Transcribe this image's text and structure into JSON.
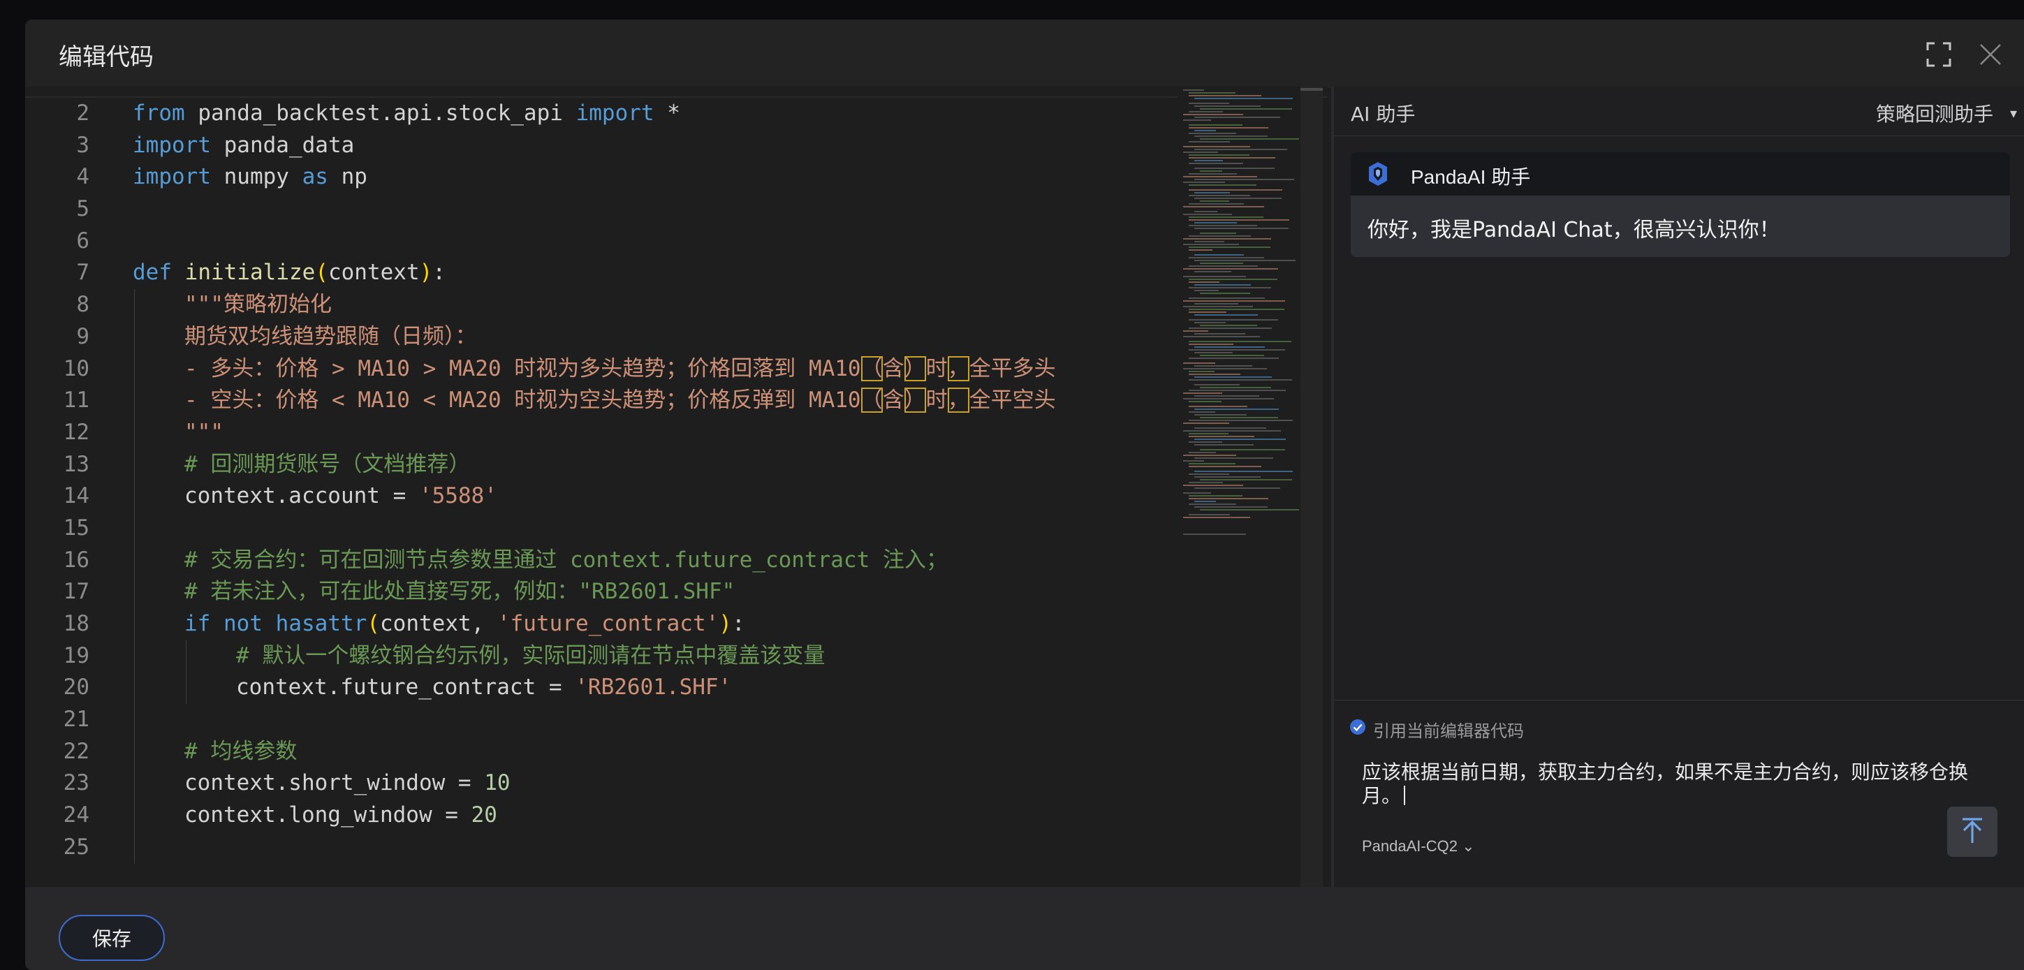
{
  "modal": {
    "title": "编辑代码",
    "icons": {
      "fullscreen": "fullscreen-icon",
      "close": "close-icon"
    }
  },
  "editor": {
    "lines": [
      {
        "num": "2",
        "tokens": [
          {
            "t": "from",
            "c": "kw"
          },
          {
            "t": " panda_backtest.api.stock_api ",
            "c": ""
          },
          {
            "t": "import",
            "c": "kw"
          },
          {
            "t": " *",
            "c": ""
          }
        ]
      },
      {
        "num": "3",
        "tokens": [
          {
            "t": "import",
            "c": "kw"
          },
          {
            "t": " panda_data",
            "c": ""
          }
        ]
      },
      {
        "num": "4",
        "tokens": [
          {
            "t": "import",
            "c": "kw"
          },
          {
            "t": " numpy ",
            "c": ""
          },
          {
            "t": "as",
            "c": "kw"
          },
          {
            "t": " np",
            "c": ""
          }
        ]
      },
      {
        "num": "5",
        "tokens": []
      },
      {
        "num": "6",
        "tokens": []
      },
      {
        "num": "7",
        "tokens": [
          {
            "t": "def",
            "c": "kw"
          },
          {
            "t": " ",
            "c": ""
          },
          {
            "t": "initialize",
            "c": "fn"
          },
          {
            "t": "(",
            "c": "paren"
          },
          {
            "t": "context",
            "c": ""
          },
          {
            "t": ")",
            "c": "paren"
          },
          {
            "t": ":",
            "c": ""
          }
        ]
      },
      {
        "num": "8",
        "indent": 1,
        "tokens": [
          {
            "t": "\"\"\"策略初始化",
            "c": "doc"
          }
        ]
      },
      {
        "num": "9",
        "indent": 1,
        "tokens": [
          {
            "t": "期货双均线趋势跟随（日频）：",
            "c": "doc"
          }
        ]
      },
      {
        "num": "10",
        "indent": 1,
        "tokens": [
          {
            "t": "- 多头：价格 > MA10 > MA20 时视为多头趋势；价格回落到 MA10",
            "c": "doc"
          },
          {
            "t": "（",
            "c": "doc hl"
          },
          {
            "t": "含",
            "c": "doc"
          },
          {
            "t": "）",
            "c": "doc hl"
          },
          {
            "t": "时",
            "c": "doc"
          },
          {
            "t": "，",
            "c": "doc hl"
          },
          {
            "t": "全平多头",
            "c": "doc"
          }
        ]
      },
      {
        "num": "11",
        "indent": 1,
        "tokens": [
          {
            "t": "- 空头：价格 < MA10 < MA20 时视为空头趋势；价格反弹到 MA10",
            "c": "doc"
          },
          {
            "t": "（",
            "c": "doc hl"
          },
          {
            "t": "含",
            "c": "doc"
          },
          {
            "t": "）",
            "c": "doc hl"
          },
          {
            "t": "时",
            "c": "doc"
          },
          {
            "t": "，",
            "c": "doc hl"
          },
          {
            "t": "全平空头",
            "c": "doc"
          }
        ]
      },
      {
        "num": "12",
        "indent": 1,
        "tokens": [
          {
            "t": "\"\"\"",
            "c": "doc"
          }
        ]
      },
      {
        "num": "13",
        "indent": 1,
        "tokens": [
          {
            "t": "# 回测期货账号（文档推荐）",
            "c": "cmt"
          }
        ]
      },
      {
        "num": "14",
        "indent": 1,
        "tokens": [
          {
            "t": "context.account = ",
            "c": ""
          },
          {
            "t": "'5588'",
            "c": "str"
          }
        ]
      },
      {
        "num": "15",
        "indent": 1,
        "tokens": []
      },
      {
        "num": "16",
        "indent": 1,
        "tokens": [
          {
            "t": "# 交易合约：可在回测节点参数里通过 context.future_contract 注入；",
            "c": "cmt"
          }
        ]
      },
      {
        "num": "17",
        "indent": 1,
        "tokens": [
          {
            "t": "# 若未注入，可在此处直接写死，例如：\"RB2601.SHF\"",
            "c": "cmt"
          }
        ]
      },
      {
        "num": "18",
        "indent": 1,
        "tokens": [
          {
            "t": "if",
            "c": "kw"
          },
          {
            "t": " ",
            "c": ""
          },
          {
            "t": "not",
            "c": "kw"
          },
          {
            "t": " ",
            "c": ""
          },
          {
            "t": "hasattr",
            "c": "kw"
          },
          {
            "t": "(",
            "c": "paren"
          },
          {
            "t": "context, ",
            "c": ""
          },
          {
            "t": "'future_contract'",
            "c": "str"
          },
          {
            "t": ")",
            "c": "paren"
          },
          {
            "t": ":",
            "c": ""
          }
        ]
      },
      {
        "num": "19",
        "indent": 2,
        "tokens": [
          {
            "t": "# 默认一个螺纹钢合约示例，实际回测请在节点中覆盖该变量",
            "c": "cmt"
          }
        ]
      },
      {
        "num": "20",
        "indent": 2,
        "tokens": [
          {
            "t": "context.future_contract = ",
            "c": ""
          },
          {
            "t": "'RB2601.SHF'",
            "c": "str"
          }
        ]
      },
      {
        "num": "21",
        "indent": 1,
        "tokens": []
      },
      {
        "num": "22",
        "indent": 1,
        "tokens": [
          {
            "t": "# 均线参数",
            "c": "cmt"
          }
        ]
      },
      {
        "num": "23",
        "indent": 1,
        "tokens": [
          {
            "t": "context.short_window = ",
            "c": ""
          },
          {
            "t": "10",
            "c": "num"
          }
        ]
      },
      {
        "num": "24",
        "indent": 1,
        "tokens": [
          {
            "t": "context.long_window = ",
            "c": ""
          },
          {
            "t": "20",
            "c": "num"
          }
        ]
      },
      {
        "num": "25",
        "indent": 1,
        "tokens": []
      }
    ]
  },
  "ai": {
    "title": "AI 助手",
    "mode": "策略回测助手",
    "message": {
      "sender": "PandaAI 助手",
      "text": "你好，我是PandaAI Chat，很高兴认识你！"
    },
    "compose": {
      "reference_label": "引用当前编辑器代码",
      "reference_checked": true,
      "input_text": "应该根据当前日期，获取主力合约，如果不是主力合约，则应该移仓换月。",
      "model": "PandaAI-CQ2"
    }
  },
  "footer": {
    "save_label": "保存"
  }
}
